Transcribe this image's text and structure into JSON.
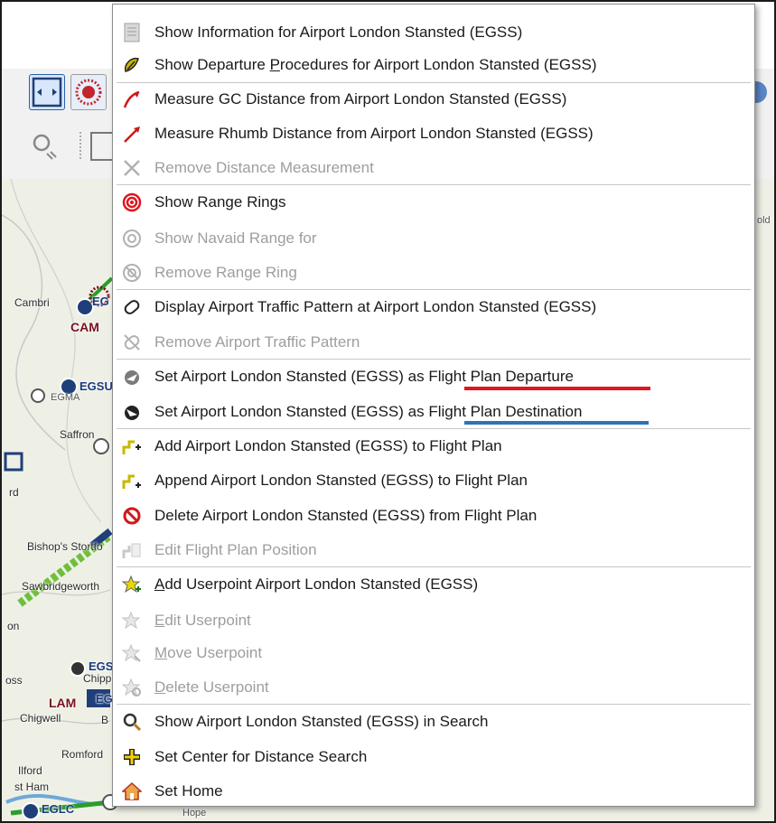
{
  "map": {
    "labels": [
      "Cambri",
      "CAM",
      "EGSU",
      "EGMA",
      "Saffron",
      "rd",
      "Bishop's Stortfo",
      "Sawbridgeworth",
      "on",
      "EGS",
      "Chippin",
      "oss",
      "LAM",
      "EGS",
      "Chigwell",
      "B",
      "Romford",
      "Ilford",
      "st Ham",
      "EGLC",
      "Hope",
      "old",
      "EG"
    ]
  },
  "menu": {
    "items": [
      {
        "label": "Show Information for Airport London Stansted (EGSS)",
        "icon": "document-icon",
        "enabled": true
      },
      {
        "label_pre": "Show Departure ",
        "label_u": "P",
        "label_post": "rocedures for Airport London Stansted (EGSS)",
        "icon": "departure-procedure-icon",
        "enabled": true
      },
      {
        "label": "Measure GC Distance from Airport London Stansted (EGSS)",
        "icon": "measure-gc-icon",
        "enabled": true
      },
      {
        "label": "Measure Rhumb Distance from Airport London Stansted (EGSS)",
        "icon": "measure-rhumb-icon",
        "enabled": true
      },
      {
        "label": "Remove Distance Measurement",
        "icon": "remove-measurement-icon",
        "enabled": false
      },
      {
        "label": "Show Range Rings",
        "icon": "range-rings-icon",
        "enabled": true
      },
      {
        "label": "Show Navaid Range for",
        "icon": "navaid-range-icon",
        "enabled": false
      },
      {
        "label": "Remove Range Ring",
        "icon": "remove-range-ring-icon",
        "enabled": false
      },
      {
        "label": "Display Airport Traffic Pattern at Airport London Stansted (EGSS)",
        "icon": "traffic-pattern-icon",
        "enabled": true
      },
      {
        "label": "Remove Airport Traffic Pattern",
        "icon": "remove-traffic-pattern-icon",
        "enabled": false
      },
      {
        "label_pre": "Set Airport London Stansted (EGSS) as ",
        "label_post": "Flight Plan Departure",
        "icon": "set-departure-icon",
        "enabled": true
      },
      {
        "label_pre": "Set Airport London Stansted (EGSS) as ",
        "label_post": "Flight Plan Destination",
        "icon": "set-destination-icon",
        "enabled": true
      },
      {
        "label": "Add Airport London Stansted (EGSS) to Flight Plan",
        "icon": "add-flightplan-icon",
        "enabled": true
      },
      {
        "label": "Append Airport London Stansted (EGSS) to Flight Plan",
        "icon": "append-flightplan-icon",
        "enabled": true
      },
      {
        "label": "Delete Airport London Stansted (EGSS) from Flight Plan",
        "icon": "delete-icon",
        "enabled": true
      },
      {
        "label": "Edit Flight Plan Position",
        "icon": "edit-position-icon",
        "enabled": false
      },
      {
        "label_u": "A",
        "label_post": "dd Userpoint Airport London Stansted (EGSS)",
        "icon": "add-userpoint-icon",
        "enabled": true
      },
      {
        "label_u": "E",
        "label_post": "dit Userpoint",
        "icon": "edit-userpoint-icon",
        "enabled": false
      },
      {
        "label_u": "M",
        "label_post": "ove Userpoint",
        "icon": "move-userpoint-icon",
        "enabled": false
      },
      {
        "label_u": "D",
        "label_post": "elete Userpoint",
        "icon": "delete-userpoint-icon",
        "enabled": false
      },
      {
        "label": "Show Airport London Stansted (EGSS) in Search",
        "icon": "search-icon",
        "enabled": true
      },
      {
        "label": "Set Center for Distance Search",
        "icon": "center-cross-icon",
        "enabled": true
      },
      {
        "label": "Set Home",
        "icon": "home-icon",
        "enabled": true
      }
    ],
    "highlight_colors": {
      "departure": "#e0151e",
      "destination": "#2d73b8"
    }
  }
}
